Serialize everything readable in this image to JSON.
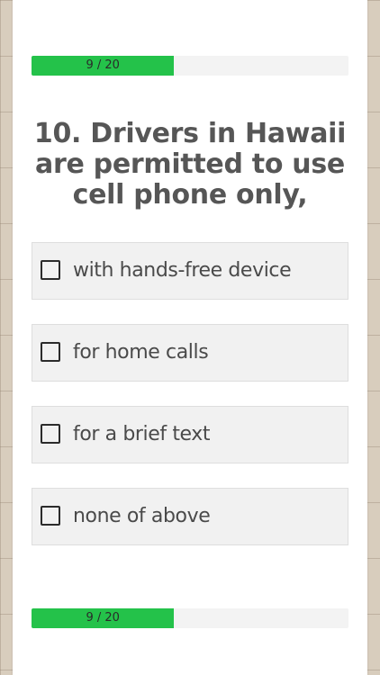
{
  "progress": {
    "current": 9,
    "total": 20,
    "label": "9 / 20",
    "fraction": 0.45,
    "fill_color": "#24c24a"
  },
  "question": {
    "text": "10. Drivers in Hawaii are permitted to use cell phone only,"
  },
  "answers": [
    {
      "label": "with hands-free device",
      "checked": false
    },
    {
      "label": "for home calls",
      "checked": false
    },
    {
      "label": "for a brief text",
      "checked": false
    },
    {
      "label": "none of above",
      "checked": false
    }
  ]
}
